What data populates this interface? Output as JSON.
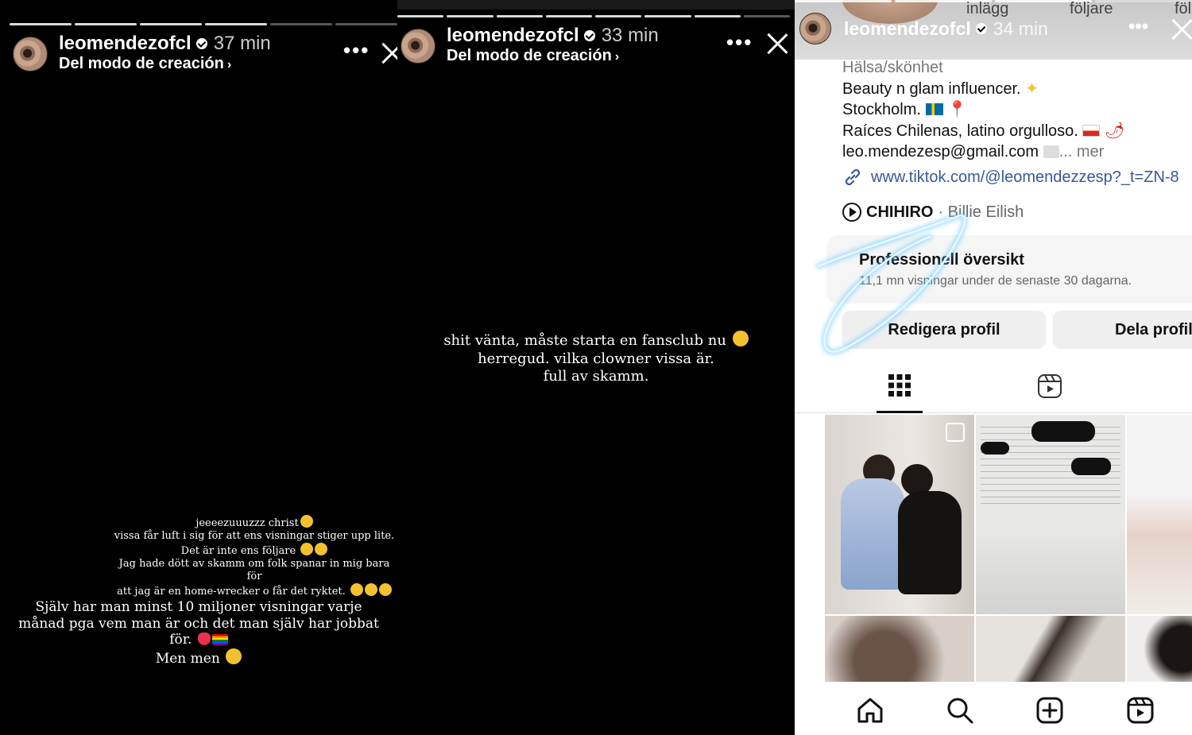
{
  "story1": {
    "username": "leomendezofcl",
    "time": "37 min",
    "subtitle": "Del modo de creación",
    "upper_text": [
      "jeeeezuuuzzz christ",
      "vissa får luft i sig för att ens visningar stiger upp lite.",
      "Det är inte ens följare",
      "Jag hade dött av skamm om folk spanar in mig bara för",
      "att jag är en home-wrecker o får det ryktet."
    ],
    "lower_text": [
      "Själv har man minst 10 miljoner visningar varje",
      "månad pga vem man är och det man själv har jobbat",
      "för.",
      "Men men"
    ]
  },
  "story2": {
    "username": "leomendezofcl",
    "time": "33 min",
    "subtitle": "Del modo de creación",
    "text": [
      "shit vänta, måste starta en fansclub nu",
      "herregud. vilka clowner vissa är.",
      "full av skamm."
    ]
  },
  "story3": {
    "username": "leomendezofcl",
    "time": "34 min",
    "stats_labels": [
      "inlägg",
      "följare",
      "föl"
    ],
    "profile": {
      "category": "Hälsa/skönhet",
      "bio_lines": [
        "Beauty n glam influencer.",
        "Stockholm.",
        "Raíces Chilenas, latino orgulloso.",
        "leo.mendezesp@gmail.com"
      ],
      "more": "... mer",
      "link": "www.tiktok.com/@leomendezzesp?_t=ZN-8",
      "music_title": "CHIHIRO",
      "music_artist": "· Billie Eilish",
      "dashboard_title": "Professionell översikt",
      "dashboard_sub": "11,1 mn visningar under de senaste 30 dagarna.",
      "edit_button": "Redigera profil",
      "share_button": "Dela profil"
    }
  }
}
